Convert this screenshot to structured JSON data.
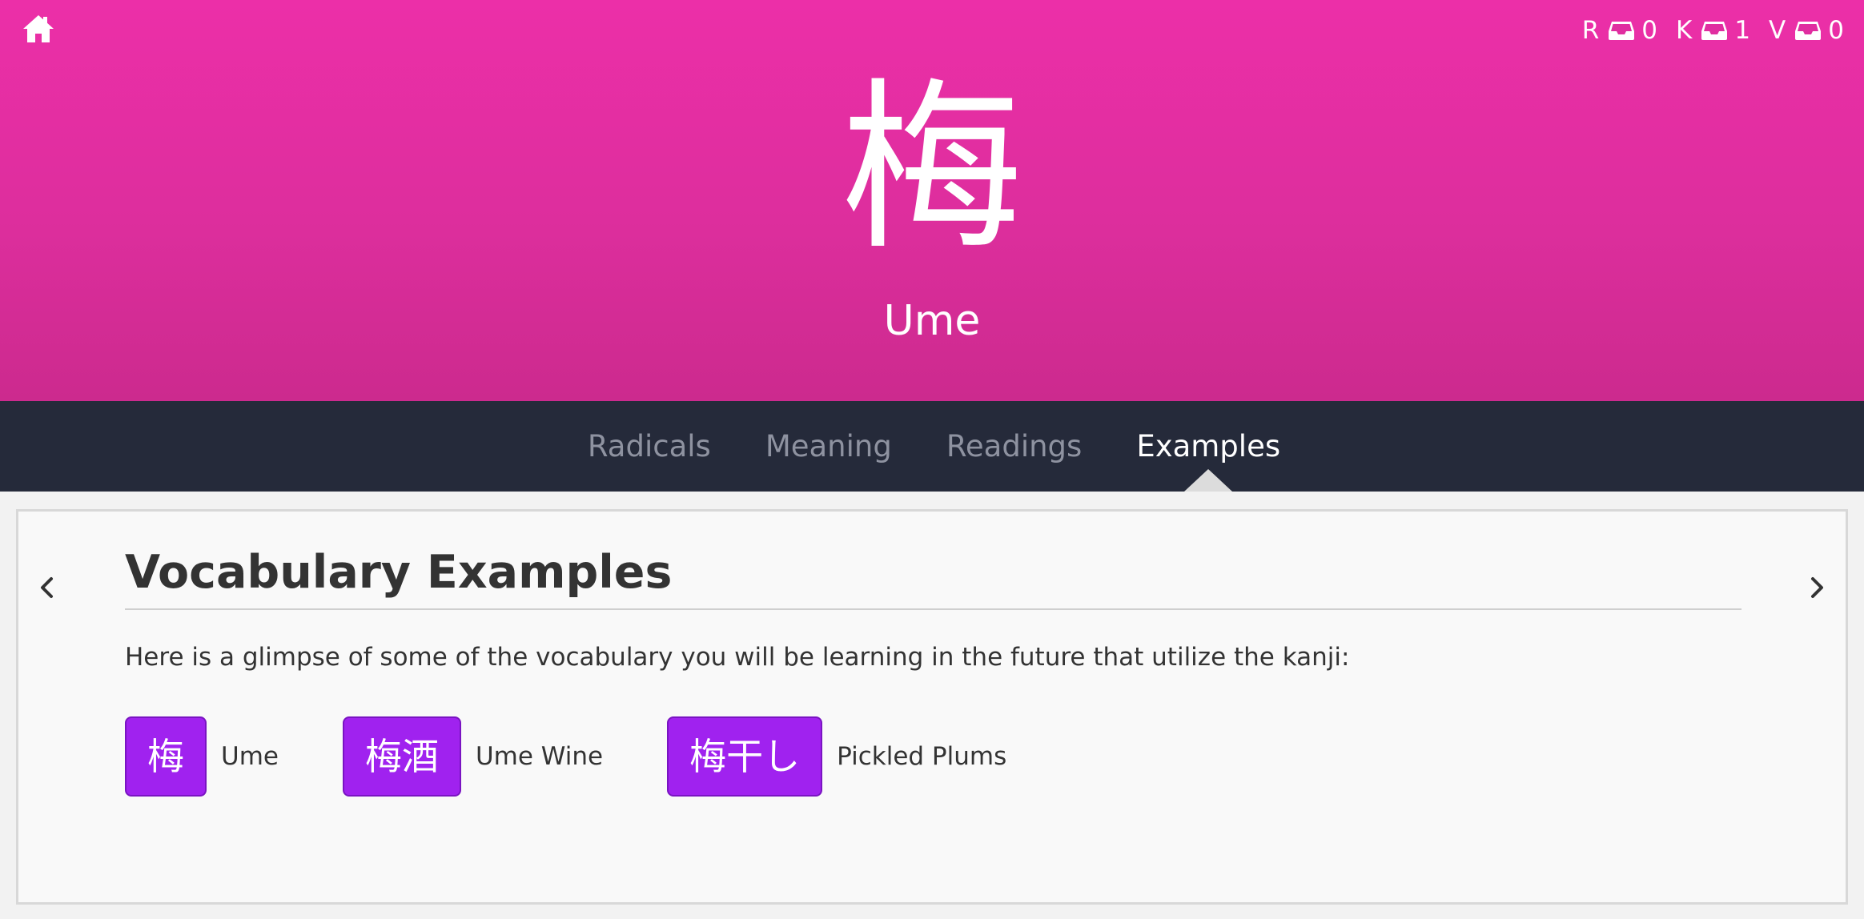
{
  "colors": {
    "header_bg": "#ec2fa8",
    "tabbar_bg": "#252a3a",
    "vocab_chip": "#a022ef",
    "tab_inactive": "#8e92a0",
    "tab_active": "#ffffff"
  },
  "header": {
    "home_icon": "home-icon",
    "kanji": "梅",
    "meaning": "Ume",
    "queues": [
      {
        "letter": "R",
        "icon": "inbox-tray-icon",
        "count": "0"
      },
      {
        "letter": "K",
        "icon": "inbox-tray-icon",
        "count": "1"
      },
      {
        "letter": "V",
        "icon": "inbox-tray-icon",
        "count": "0"
      }
    ]
  },
  "tabs": [
    {
      "label": "Radicals",
      "active": false
    },
    {
      "label": "Meaning",
      "active": false
    },
    {
      "label": "Readings",
      "active": false
    },
    {
      "label": "Examples",
      "active": true
    }
  ],
  "panel": {
    "prev_icon": "chevron-left-icon",
    "next_icon": "chevron-right-icon",
    "title": "Vocabulary Examples",
    "intro": "Here is a glimpse of some of the vocabulary you will be learning in the future that utilize the kanji:",
    "examples": [
      {
        "japanese": "梅",
        "english": "Ume"
      },
      {
        "japanese": "梅酒",
        "english": "Ume Wine"
      },
      {
        "japanese": "梅干し",
        "english": "Pickled Plums"
      }
    ]
  }
}
